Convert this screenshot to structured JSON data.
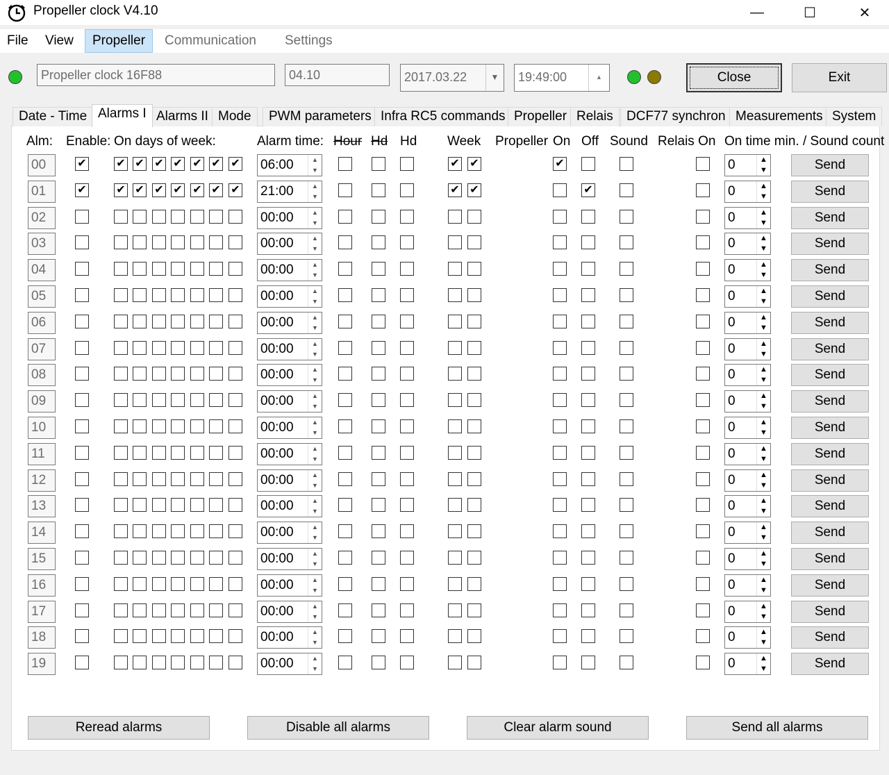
{
  "window": {
    "title": "Propeller clock V4.10",
    "minimize": "—",
    "maximize": "☐",
    "close": "✕"
  },
  "menu": [
    {
      "label": "File",
      "state": "normal"
    },
    {
      "label": "View",
      "state": "normal"
    },
    {
      "label": "Propeller",
      "state": "active"
    },
    {
      "label": "Communication",
      "state": "disabled"
    },
    {
      "label": "Settings",
      "state": "disabled"
    }
  ],
  "status": {
    "device_name": "Propeller clock 16F88",
    "version": "04.10",
    "date": "2017.03.22",
    "time": "19:49:00",
    "close_label": "Close",
    "exit_label": "Exit",
    "led_colors": {
      "connection": "#22c02c",
      "led_a": "#22c02c",
      "led_b": "#8a7a00"
    }
  },
  "tabs": [
    "Date - Time",
    "Alarms I",
    "Alarms II",
    "Mode",
    "PWM parameters",
    "Infra RC5 commands",
    "Propeller",
    "Relais",
    "DCF77 synchron",
    "Measurements",
    "System"
  ],
  "active_tab": "Alarms I",
  "headers": {
    "alm": "Alm:",
    "enable": "Enable:",
    "days": "On days of week:",
    "alarm_time": "Alarm time:",
    "hour": "Hour",
    "hd1": "Hd",
    "hd2": "Hd",
    "week": "Week",
    "propeller": "Propeller",
    "on": "On",
    "off": "Off",
    "sound": "Sound",
    "relais_on": "Relais On",
    "ontime": "On time min. / Sound count"
  },
  "send_label": "Send",
  "alarms": [
    {
      "num": "00",
      "enable": true,
      "days": [
        true,
        true,
        true,
        true,
        true,
        true,
        true
      ],
      "time": "06:00",
      "hour": false,
      "hd1": false,
      "hd2": false,
      "week": [
        true,
        true
      ],
      "on": true,
      "off": false,
      "sound": false,
      "relais": false,
      "count": "0"
    },
    {
      "num": "01",
      "enable": true,
      "days": [
        true,
        true,
        true,
        true,
        true,
        true,
        true
      ],
      "time": "21:00",
      "hour": false,
      "hd1": false,
      "hd2": false,
      "week": [
        true,
        true
      ],
      "on": false,
      "off": true,
      "sound": false,
      "relais": false,
      "count": "0"
    },
    {
      "num": "02",
      "enable": false,
      "days": [
        false,
        false,
        false,
        false,
        false,
        false,
        false
      ],
      "time": "00:00",
      "hour": false,
      "hd1": false,
      "hd2": false,
      "week": [
        false,
        false
      ],
      "on": false,
      "off": false,
      "sound": false,
      "relais": false,
      "count": "0"
    },
    {
      "num": "03",
      "enable": false,
      "days": [
        false,
        false,
        false,
        false,
        false,
        false,
        false
      ],
      "time": "00:00",
      "hour": false,
      "hd1": false,
      "hd2": false,
      "week": [
        false,
        false
      ],
      "on": false,
      "off": false,
      "sound": false,
      "relais": false,
      "count": "0"
    },
    {
      "num": "04",
      "enable": false,
      "days": [
        false,
        false,
        false,
        false,
        false,
        false,
        false
      ],
      "time": "00:00",
      "hour": false,
      "hd1": false,
      "hd2": false,
      "week": [
        false,
        false
      ],
      "on": false,
      "off": false,
      "sound": false,
      "relais": false,
      "count": "0"
    },
    {
      "num": "05",
      "enable": false,
      "days": [
        false,
        false,
        false,
        false,
        false,
        false,
        false
      ],
      "time": "00:00",
      "hour": false,
      "hd1": false,
      "hd2": false,
      "week": [
        false,
        false
      ],
      "on": false,
      "off": false,
      "sound": false,
      "relais": false,
      "count": "0"
    },
    {
      "num": "06",
      "enable": false,
      "days": [
        false,
        false,
        false,
        false,
        false,
        false,
        false
      ],
      "time": "00:00",
      "hour": false,
      "hd1": false,
      "hd2": false,
      "week": [
        false,
        false
      ],
      "on": false,
      "off": false,
      "sound": false,
      "relais": false,
      "count": "0"
    },
    {
      "num": "07",
      "enable": false,
      "days": [
        false,
        false,
        false,
        false,
        false,
        false,
        false
      ],
      "time": "00:00",
      "hour": false,
      "hd1": false,
      "hd2": false,
      "week": [
        false,
        false
      ],
      "on": false,
      "off": false,
      "sound": false,
      "relais": false,
      "count": "0"
    },
    {
      "num": "08",
      "enable": false,
      "days": [
        false,
        false,
        false,
        false,
        false,
        false,
        false
      ],
      "time": "00:00",
      "hour": false,
      "hd1": false,
      "hd2": false,
      "week": [
        false,
        false
      ],
      "on": false,
      "off": false,
      "sound": false,
      "relais": false,
      "count": "0"
    },
    {
      "num": "09",
      "enable": false,
      "days": [
        false,
        false,
        false,
        false,
        false,
        false,
        false
      ],
      "time": "00:00",
      "hour": false,
      "hd1": false,
      "hd2": false,
      "week": [
        false,
        false
      ],
      "on": false,
      "off": false,
      "sound": false,
      "relais": false,
      "count": "0"
    },
    {
      "num": "10",
      "enable": false,
      "days": [
        false,
        false,
        false,
        false,
        false,
        false,
        false
      ],
      "time": "00:00",
      "hour": false,
      "hd1": false,
      "hd2": false,
      "week": [
        false,
        false
      ],
      "on": false,
      "off": false,
      "sound": false,
      "relais": false,
      "count": "0"
    },
    {
      "num": "11",
      "enable": false,
      "days": [
        false,
        false,
        false,
        false,
        false,
        false,
        false
      ],
      "time": "00:00",
      "hour": false,
      "hd1": false,
      "hd2": false,
      "week": [
        false,
        false
      ],
      "on": false,
      "off": false,
      "sound": false,
      "relais": false,
      "count": "0"
    },
    {
      "num": "12",
      "enable": false,
      "days": [
        false,
        false,
        false,
        false,
        false,
        false,
        false
      ],
      "time": "00:00",
      "hour": false,
      "hd1": false,
      "hd2": false,
      "week": [
        false,
        false
      ],
      "on": false,
      "off": false,
      "sound": false,
      "relais": false,
      "count": "0"
    },
    {
      "num": "13",
      "enable": false,
      "days": [
        false,
        false,
        false,
        false,
        false,
        false,
        false
      ],
      "time": "00:00",
      "hour": false,
      "hd1": false,
      "hd2": false,
      "week": [
        false,
        false
      ],
      "on": false,
      "off": false,
      "sound": false,
      "relais": false,
      "count": "0"
    },
    {
      "num": "14",
      "enable": false,
      "days": [
        false,
        false,
        false,
        false,
        false,
        false,
        false
      ],
      "time": "00:00",
      "hour": false,
      "hd1": false,
      "hd2": false,
      "week": [
        false,
        false
      ],
      "on": false,
      "off": false,
      "sound": false,
      "relais": false,
      "count": "0"
    },
    {
      "num": "15",
      "enable": false,
      "days": [
        false,
        false,
        false,
        false,
        false,
        false,
        false
      ],
      "time": "00:00",
      "hour": false,
      "hd1": false,
      "hd2": false,
      "week": [
        false,
        false
      ],
      "on": false,
      "off": false,
      "sound": false,
      "relais": false,
      "count": "0"
    },
    {
      "num": "16",
      "enable": false,
      "days": [
        false,
        false,
        false,
        false,
        false,
        false,
        false
      ],
      "time": "00:00",
      "hour": false,
      "hd1": false,
      "hd2": false,
      "week": [
        false,
        false
      ],
      "on": false,
      "off": false,
      "sound": false,
      "relais": false,
      "count": "0"
    },
    {
      "num": "17",
      "enable": false,
      "days": [
        false,
        false,
        false,
        false,
        false,
        false,
        false
      ],
      "time": "00:00",
      "hour": false,
      "hd1": false,
      "hd2": false,
      "week": [
        false,
        false
      ],
      "on": false,
      "off": false,
      "sound": false,
      "relais": false,
      "count": "0"
    },
    {
      "num": "18",
      "enable": false,
      "days": [
        false,
        false,
        false,
        false,
        false,
        false,
        false
      ],
      "time": "00:00",
      "hour": false,
      "hd1": false,
      "hd2": false,
      "week": [
        false,
        false
      ],
      "on": false,
      "off": false,
      "sound": false,
      "relais": false,
      "count": "0"
    },
    {
      "num": "19",
      "enable": false,
      "days": [
        false,
        false,
        false,
        false,
        false,
        false,
        false
      ],
      "time": "00:00",
      "hour": false,
      "hd1": false,
      "hd2": false,
      "week": [
        false,
        false
      ],
      "on": false,
      "off": false,
      "sound": false,
      "relais": false,
      "count": "0"
    }
  ],
  "bottom_buttons": [
    "Reread alarms",
    "Disable all alarms",
    "Clear alarm sound",
    "Send all alarms"
  ]
}
